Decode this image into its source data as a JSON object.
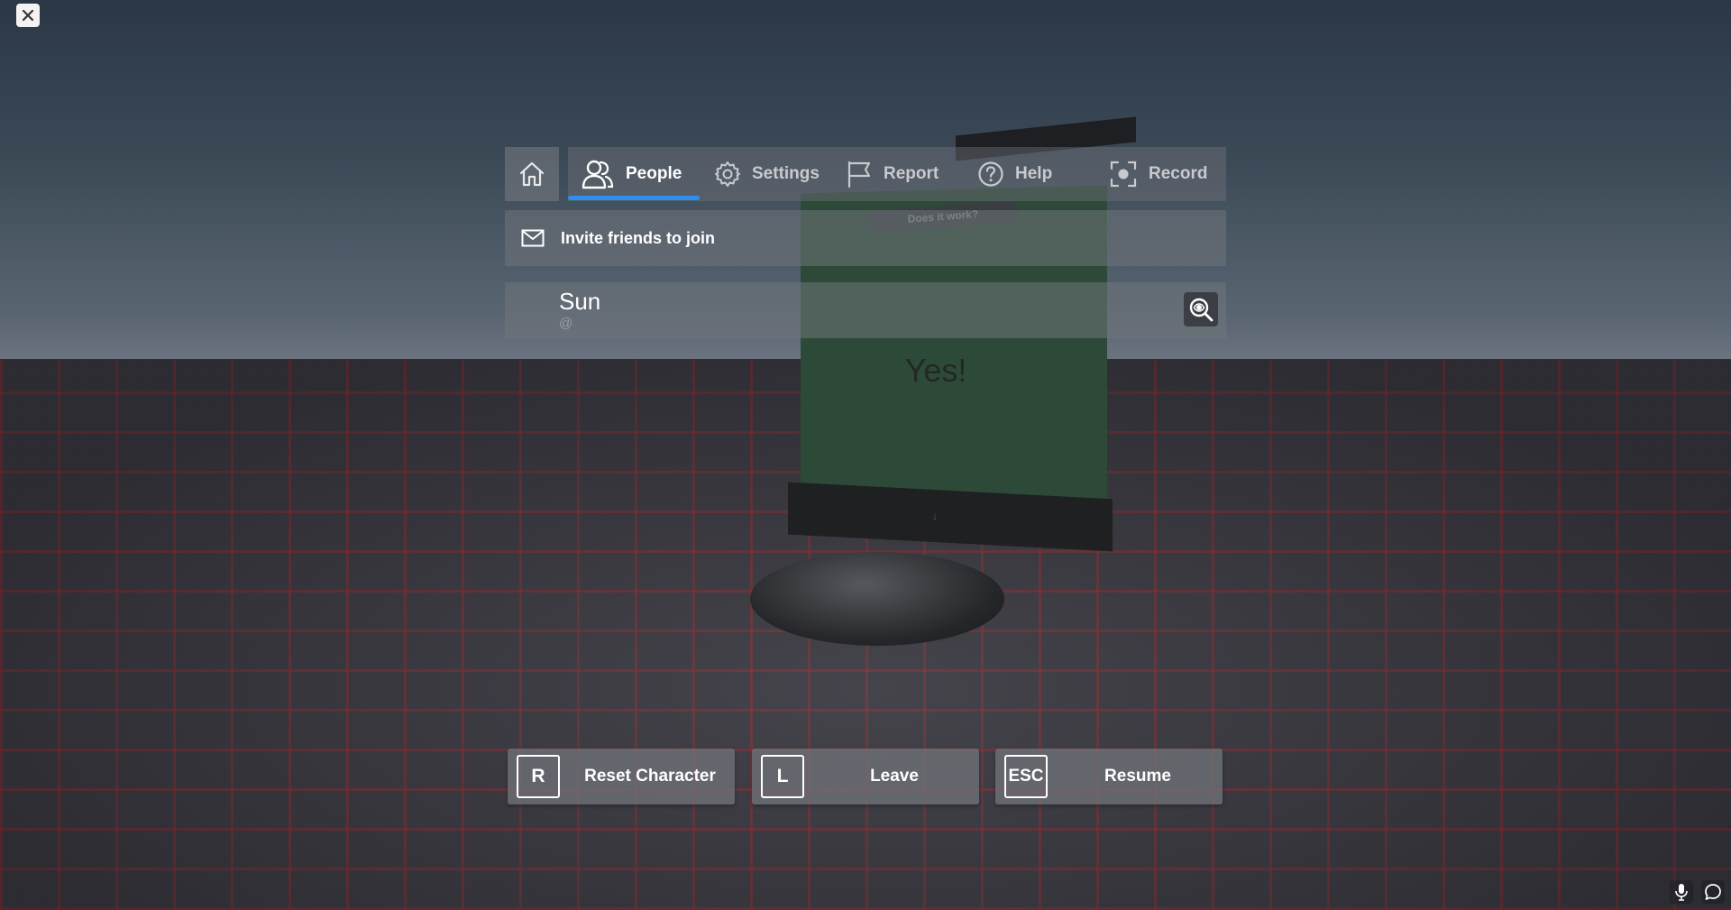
{
  "window": {
    "close_icon": "close-icon"
  },
  "nav": {
    "home_icon": "home-icon",
    "tabs": [
      {
        "label": "People",
        "icon": "people-icon",
        "active": true
      },
      {
        "label": "Settings",
        "icon": "gear-icon",
        "active": false
      },
      {
        "label": "Report",
        "icon": "flag-icon",
        "active": false
      },
      {
        "label": "Help",
        "icon": "help-icon",
        "active": false
      },
      {
        "label": "Record",
        "icon": "record-icon",
        "active": false
      }
    ],
    "active_underline_color": "#2e8ff0"
  },
  "invite": {
    "label": "Invite friends to join",
    "icon": "mail-icon"
  },
  "players": [
    {
      "name": "Sun",
      "handle": "@",
      "inspect_icon": "inspect-icon"
    }
  ],
  "scene": {
    "sign_plaque": "Does it work?",
    "sign_text": "Yes!",
    "sign_base_glyph": "↓"
  },
  "actions": [
    {
      "key": "R",
      "label": "Reset Character"
    },
    {
      "key": "L",
      "label": "Leave"
    },
    {
      "key": "ESC",
      "label": "Resume"
    }
  ],
  "corner": {
    "mic_icon": "microphone-icon",
    "chat_icon": "chat-icon"
  }
}
